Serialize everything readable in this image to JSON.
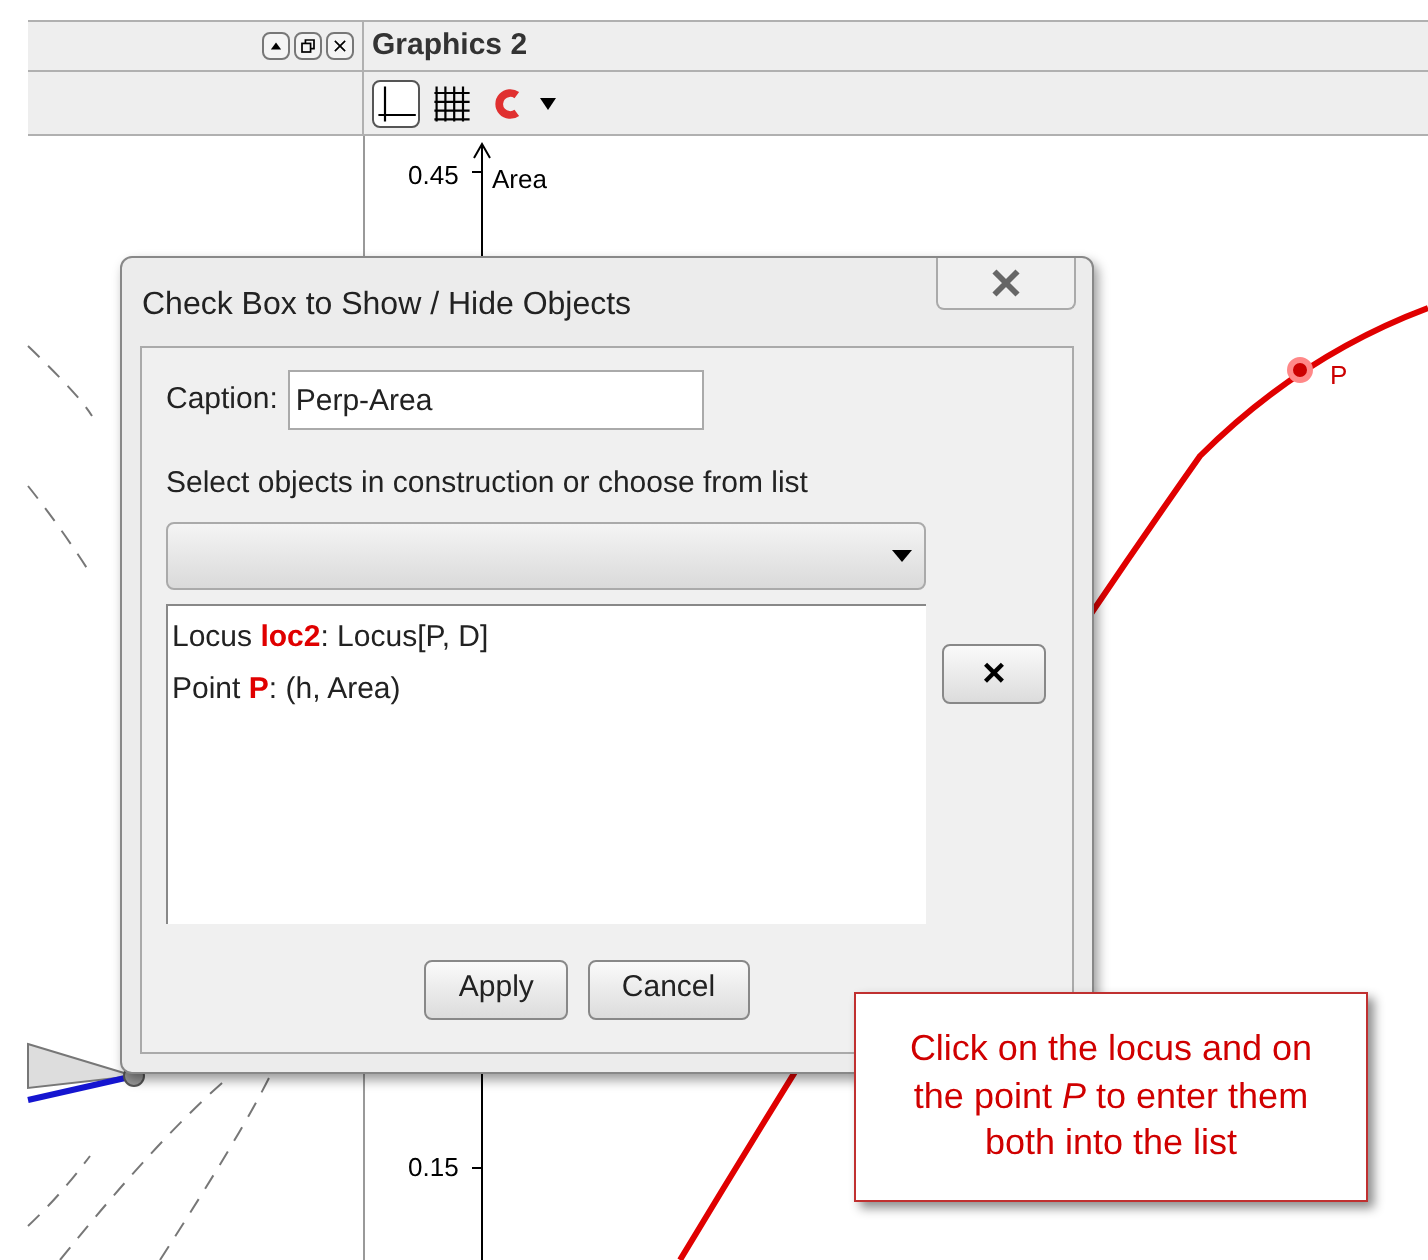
{
  "left_view": {
    "window_buttons": [
      {
        "kind": "maximize"
      },
      {
        "kind": "restore"
      },
      {
        "kind": "close"
      }
    ]
  },
  "graphics_view": {
    "title": "Graphics 2",
    "toolbar": [
      {
        "kind": "axes",
        "selected": true
      },
      {
        "kind": "grid",
        "selected": false
      },
      {
        "kind": "magnet",
        "selected": false
      }
    ],
    "y_axis": {
      "label": "Area",
      "ticks": [
        "0.45",
        "0.15"
      ]
    },
    "point": {
      "label": "P"
    }
  },
  "dialog": {
    "title": "Check Box to Show / Hide Objects",
    "caption_label": "Caption:",
    "caption_value": "Perp-Area",
    "instruction": "Select objects in construction or choose from list",
    "objects": [
      {
        "type": "Locus",
        "name": "loc2",
        "definition": ": Locus[P, D]"
      },
      {
        "type": "Point",
        "name": "P",
        "definition": ": (h, Area)"
      }
    ],
    "remove_button": "×",
    "buttons": [
      "Apply",
      "Cancel"
    ]
  },
  "callout": "Click on the locus and on the point *P* to enter them both into the list"
}
